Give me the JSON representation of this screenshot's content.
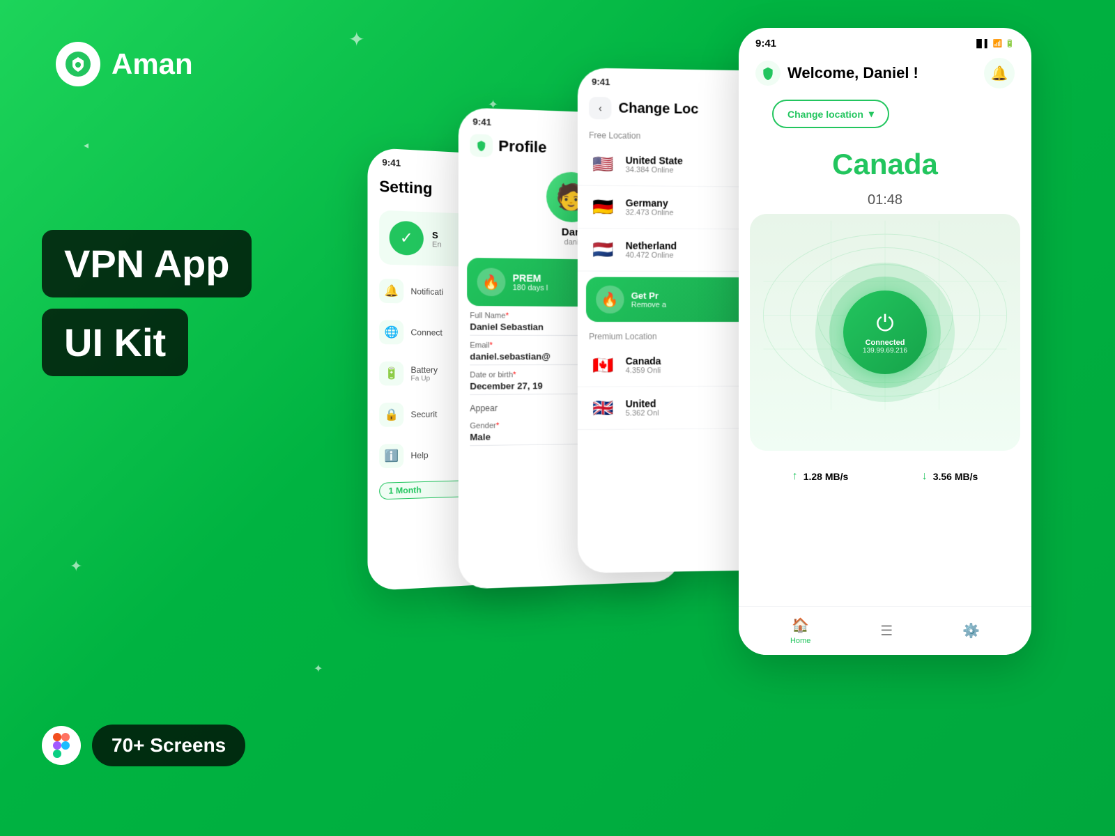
{
  "app": {
    "name": "Aman",
    "tagline": "VPN App UI Kit",
    "screens_count": "70+ Screens"
  },
  "hero": {
    "line1": "VPN App",
    "line2": "UI Kit",
    "screens": "70+ Screens"
  },
  "phone_settings": {
    "time": "9:41",
    "title": "Setting",
    "vpn_label": "S",
    "vpn_sublabel": "En",
    "items": [
      {
        "icon": "🌐",
        "label": "Connect"
      },
      {
        "icon": "🔋",
        "label": "Battery",
        "sub": "Fa\nUp"
      },
      {
        "icon": "🔒",
        "label": "Securit"
      }
    ],
    "month_label": "1 Month"
  },
  "phone_profile": {
    "time": "9:41",
    "title": "Profile",
    "user_name": "Dan",
    "user_handle": "dani",
    "premium_label": "PREM",
    "premium_sub": "180 days l",
    "fields": [
      {
        "label": "Full Name*",
        "value": "Daniel Sebastian"
      },
      {
        "label": "Email*",
        "value": "daniel.sebastian@"
      },
      {
        "label": "Date or birth*",
        "value": "December 27, 19"
      },
      {
        "label": "Gender*",
        "value": "Male"
      }
    ],
    "appear_label": "Appear"
  },
  "phone_location": {
    "time": "9:41",
    "title": "Change Loc",
    "free_label": "Free Location",
    "locations_free": [
      {
        "flag": "🇺🇸",
        "name": "United State",
        "count": "34.384 Online"
      },
      {
        "flag": "🇩🇪",
        "name": "Germany",
        "count": "32.473 Online"
      },
      {
        "flag": "🇳🇱",
        "name": "Netherland",
        "count": "40.472 Online"
      }
    ],
    "get_premium_label": "Get Pr",
    "get_premium_sub": "Remove a",
    "premium_label": "Premium Location",
    "locations_premium": [
      {
        "flag": "🇨🇦",
        "name": "Canada",
        "count": "4.359 Onli"
      },
      {
        "flag": "🇬🇧",
        "name": "United",
        "count": "5.362 Onl"
      }
    ]
  },
  "phone_home": {
    "time": "9:41",
    "greeting": "Welcome, Daniel !",
    "change_location_btn": "Change location",
    "current_country": "Canada",
    "connection_time": "01:48",
    "connected_label": "Connected",
    "ip_address": "139.99.69.216",
    "speed_up": "1.28 MB/s",
    "speed_down": "3.56 MB/s",
    "nav_items": [
      {
        "icon": "🏠",
        "label": "Home",
        "active": true
      },
      {
        "icon": "☰",
        "label": "",
        "active": false
      },
      {
        "icon": "⚙️",
        "label": "",
        "active": false
      }
    ]
  }
}
